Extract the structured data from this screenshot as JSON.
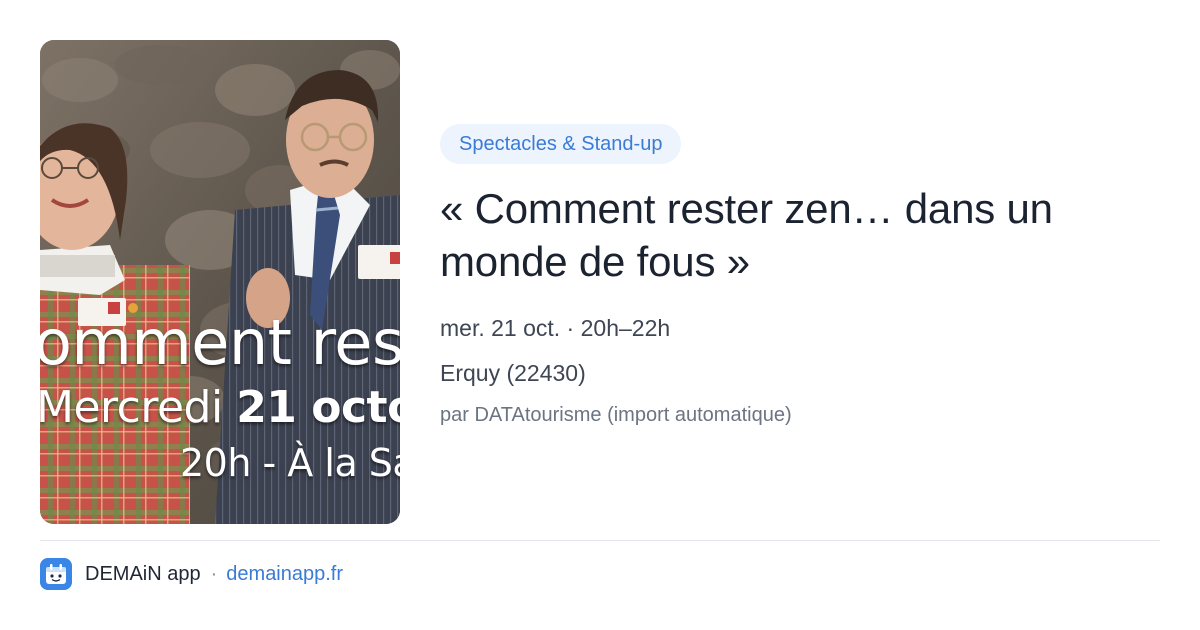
{
  "event": {
    "category": "Spectacles & Stand-up",
    "title": "« Comment rester zen… dans un monde de fous »",
    "date_time": "mer. 21 oct. · 20h–22h",
    "location": "Erquy (22430)",
    "source": "par DATAtourisme (import automatique)"
  },
  "poster": {
    "line1": "omment reste",
    "line2_light": "Mercredi ",
    "line2_bold": "21 octo",
    "line3": "20h -  À la Sa"
  },
  "footer": {
    "app_name": "DEMAiN app",
    "separator": "·",
    "domain": "demainapp.fr"
  },
  "colors": {
    "accent": "#3a7bd5",
    "badge_bg": "#edf4fd",
    "app_icon": "#3a86e6"
  }
}
